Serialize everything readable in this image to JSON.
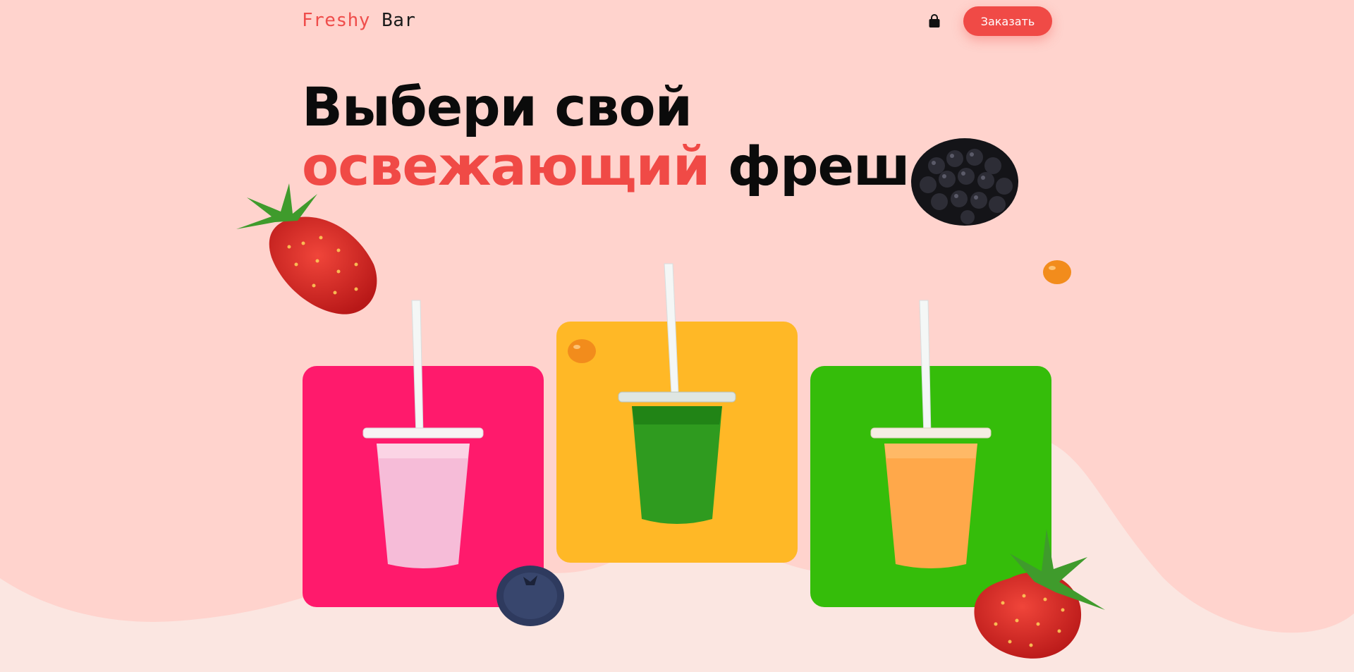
{
  "header": {
    "logo_part1": "Freshy",
    "logo_part2": "Bar",
    "cart_icon": "shopping-bag-icon",
    "order_button": "Заказать"
  },
  "hero": {
    "title_line1": "Выбери свой",
    "title_accent": "освежающий",
    "title_tail": "фреш"
  },
  "colors": {
    "background_top": "#ffd3cd",
    "background_bottom": "#fbe6e1",
    "accent": "#f04a46",
    "card_pink": "#ff1a6c",
    "card_yellow": "#ffb826",
    "card_green": "#35bd0a"
  },
  "products": [
    {
      "name": "pink-smoothie-cup",
      "drink_color": "#f6bcd8",
      "card_color": "#ff1a6c"
    },
    {
      "name": "green-smoothie-cup",
      "drink_color": "#2f9b1f",
      "card_color": "#ffb826"
    },
    {
      "name": "orange-smoothie-cup",
      "drink_color": "#ffa84a",
      "card_color": "#35bd0a"
    }
  ],
  "decorations": [
    "strawberry-icon",
    "blackberry-icon",
    "sea-buckthorn-berry-icon",
    "blueberry-icon"
  ]
}
